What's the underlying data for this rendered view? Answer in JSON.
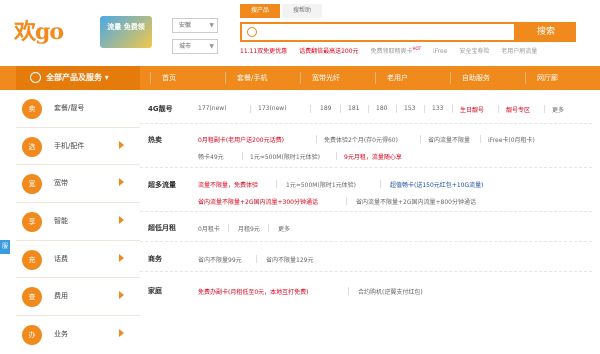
{
  "logo": {
    "text": "欢go",
    "badge": "流量 免费领"
  },
  "region": {
    "province": "安徽",
    "city": "城市"
  },
  "search": {
    "tabs": [
      "搜产品",
      "搜帮助"
    ],
    "placeholder": "",
    "button": "搜索",
    "hot": [
      {
        "text": "11.11双免更优惠",
        "color": "red"
      },
      {
        "text": "话费翻倍最高送200元",
        "color": "red"
      },
      {
        "text": "免费领取畅爽卡",
        "color": "gray",
        "badge": "HOT"
      },
      {
        "text": "iFree",
        "color": "gray"
      },
      {
        "text": "安全宝寿险",
        "color": "gray"
      },
      {
        "text": "老用户刷流量",
        "color": "gray"
      }
    ]
  },
  "nav": {
    "all": "全部产品及服务",
    "items": [
      "首页",
      "套餐/手机",
      "宽带光纤",
      "老用户",
      "自助服务",
      "网厅廊"
    ]
  },
  "sidebar": {
    "items": [
      {
        "icon": "卖",
        "label": "套餐/靓号"
      },
      {
        "icon": "选",
        "label": "手机/配件"
      },
      {
        "icon": "宽",
        "label": "宽带"
      },
      {
        "icon": "享",
        "label": "智能"
      },
      {
        "icon": "充",
        "label": "话费"
      },
      {
        "icon": "查",
        "label": "费用"
      },
      {
        "icon": "办",
        "label": "业务"
      }
    ],
    "side_tag": "服"
  },
  "main": {
    "rows": [
      {
        "title": "4G靓号",
        "links": [
          {
            "text": "177(new)",
            "color": "gray"
          },
          {
            "text": "173(new)",
            "color": "gray"
          },
          {
            "text": "189",
            "color": "gray"
          },
          {
            "text": "181",
            "color": "gray"
          },
          {
            "text": "180",
            "color": "gray"
          },
          {
            "text": "153",
            "color": "gray"
          },
          {
            "text": "133",
            "color": "gray"
          },
          {
            "text": "生日靓号",
            "color": "red"
          },
          {
            "text": "靓号专区",
            "color": "red"
          },
          {
            "text": "更多",
            "color": "gray"
          }
        ]
      },
      {
        "title": "热卖",
        "lines": [
          [
            {
              "text": "0月租副卡(老用户送200元话费)",
              "color": "red"
            },
            {
              "text": "免费体验2个月(存0元得60)",
              "color": "gray"
            },
            {
              "text": "省内流量不限量",
              "color": "gray"
            },
            {
              "text": "iFree卡(0月租卡)",
              "color": "gray"
            }
          ],
          [
            {
              "text": "畅卡49元",
              "color": "gray"
            },
            {
              "text": "1元=500M(限时1元体验)",
              "color": "gray"
            },
            {
              "text": "9元月租，流量随心享",
              "color": "red"
            }
          ]
        ]
      },
      {
        "title": "超多流量",
        "lines": [
          [
            {
              "text": "流量不限量，免费体验",
              "color": "red"
            },
            {
              "text": "1元=500M(限时1元体验)",
              "color": "gray"
            },
            {
              "text": "超值畅卡(送150元红包+10G流量)",
              "color": "blue"
            }
          ],
          [
            {
              "text": "省内流量不限量+2G国内流量+300分钟通话",
              "color": "red"
            },
            {
              "text": "省内流量不限量+2G国内流量+800分钟通话",
              "color": "gray"
            }
          ]
        ]
      },
      {
        "title": "超低月租",
        "links": [
          {
            "text": "0月租卡",
            "color": "gray"
          },
          {
            "text": "月租9元",
            "color": "gray"
          },
          {
            "text": "更多",
            "color": "gray"
          }
        ]
      },
      {
        "title": "商务",
        "links": [
          {
            "text": "省内不限量99元",
            "color": "gray"
          },
          {
            "text": "省内不限量129元",
            "color": "gray"
          }
        ]
      },
      {
        "title": "家庭",
        "links": [
          {
            "text": "免费办副卡(月租低至0元，本地互打免费)",
            "color": "red"
          },
          {
            "text": "合约购机(逆翼支付红包)",
            "color": "gray"
          }
        ]
      }
    ]
  }
}
